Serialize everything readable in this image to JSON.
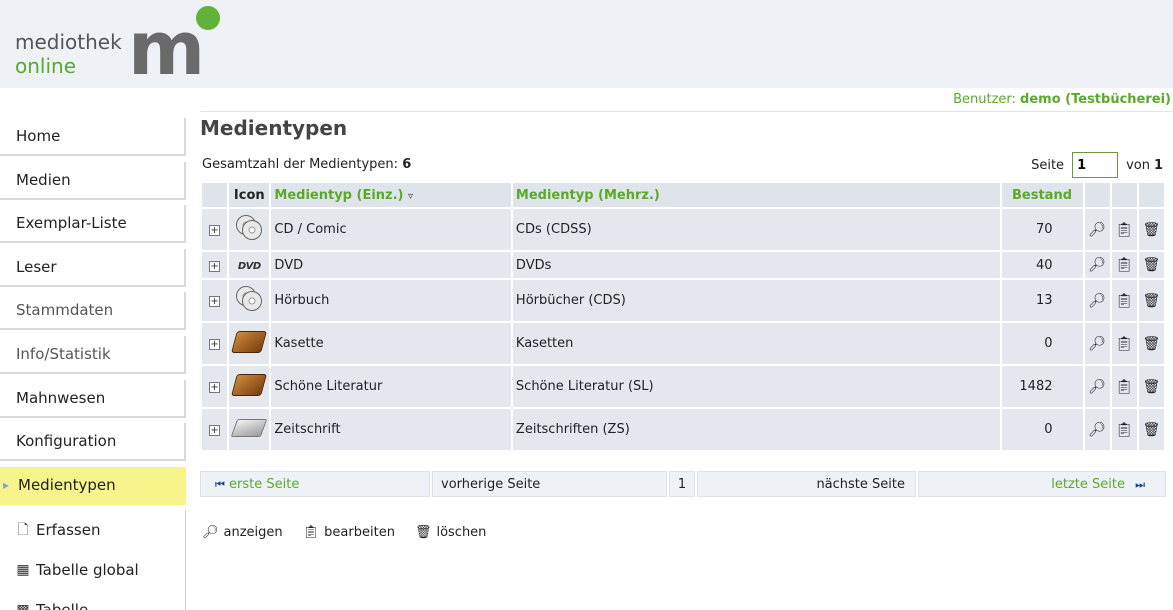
{
  "header": {
    "logo_line1": "mediothek",
    "logo_line2": "online",
    "logo_mark": "m",
    "user_label": "Benutzer:",
    "user_value": "demo (Testbücherei)"
  },
  "sidebar": {
    "items": [
      {
        "label": "Home"
      },
      {
        "label": "Medien"
      },
      {
        "label": "Exemplar-Liste"
      },
      {
        "label": "Leser"
      },
      {
        "label": "Stammdaten"
      },
      {
        "label": "Info/Statistik"
      },
      {
        "label": "Mahnwesen"
      },
      {
        "label": "Konfiguration"
      },
      {
        "label": "Medientypen"
      }
    ],
    "sub_items": [
      {
        "label": "Erfassen",
        "icon": "document-icon"
      },
      {
        "label": "Tabelle global",
        "icon": "table-icon"
      },
      {
        "label": "Tabelle",
        "icon": "table-edit-icon"
      }
    ]
  },
  "main": {
    "title": "Medientypen",
    "total_label": "Gesamtzahl der Medientypen:",
    "total_value": "6",
    "page_label": "Seite",
    "page_value": "1",
    "of_label": "von",
    "of_value": "1",
    "columns": [
      "Icon",
      "Medientyp (Einz.)",
      "Medientyp (Mehrz.)",
      "Bestand"
    ],
    "sort_indicator": "▿",
    "rows": [
      {
        "icon": "cd-icon",
        "single": "CD / Comic",
        "plural": "CDs (CDSS)",
        "stock": "70"
      },
      {
        "icon": "dvd-icon",
        "single": "DVD",
        "plural": "DVDs",
        "stock": "40"
      },
      {
        "icon": "cd-icon",
        "single": "Hörbuch",
        "plural": "Hörbücher (CDS)",
        "stock": "13"
      },
      {
        "icon": "book-icon",
        "single": "Kasette",
        "plural": "Kasetten",
        "stock": "0"
      },
      {
        "icon": "book-icon",
        "single": "Schöne Literatur",
        "plural": "Schöne Literatur (SL)",
        "stock": "1482"
      },
      {
        "icon": "magazine-icon",
        "single": "Zeitschrift",
        "plural": "Zeitschriften (ZS)",
        "stock": "0"
      }
    ],
    "dvd_icon_text": "DVD"
  },
  "pager": {
    "first": "erste Seite",
    "prev": "vorherige Seite",
    "current": "1",
    "next": "nächste Seite",
    "last": "letzte Seite"
  },
  "legend": {
    "view": "anzeigen",
    "edit": "bearbeiten",
    "delete": "löschen"
  }
}
